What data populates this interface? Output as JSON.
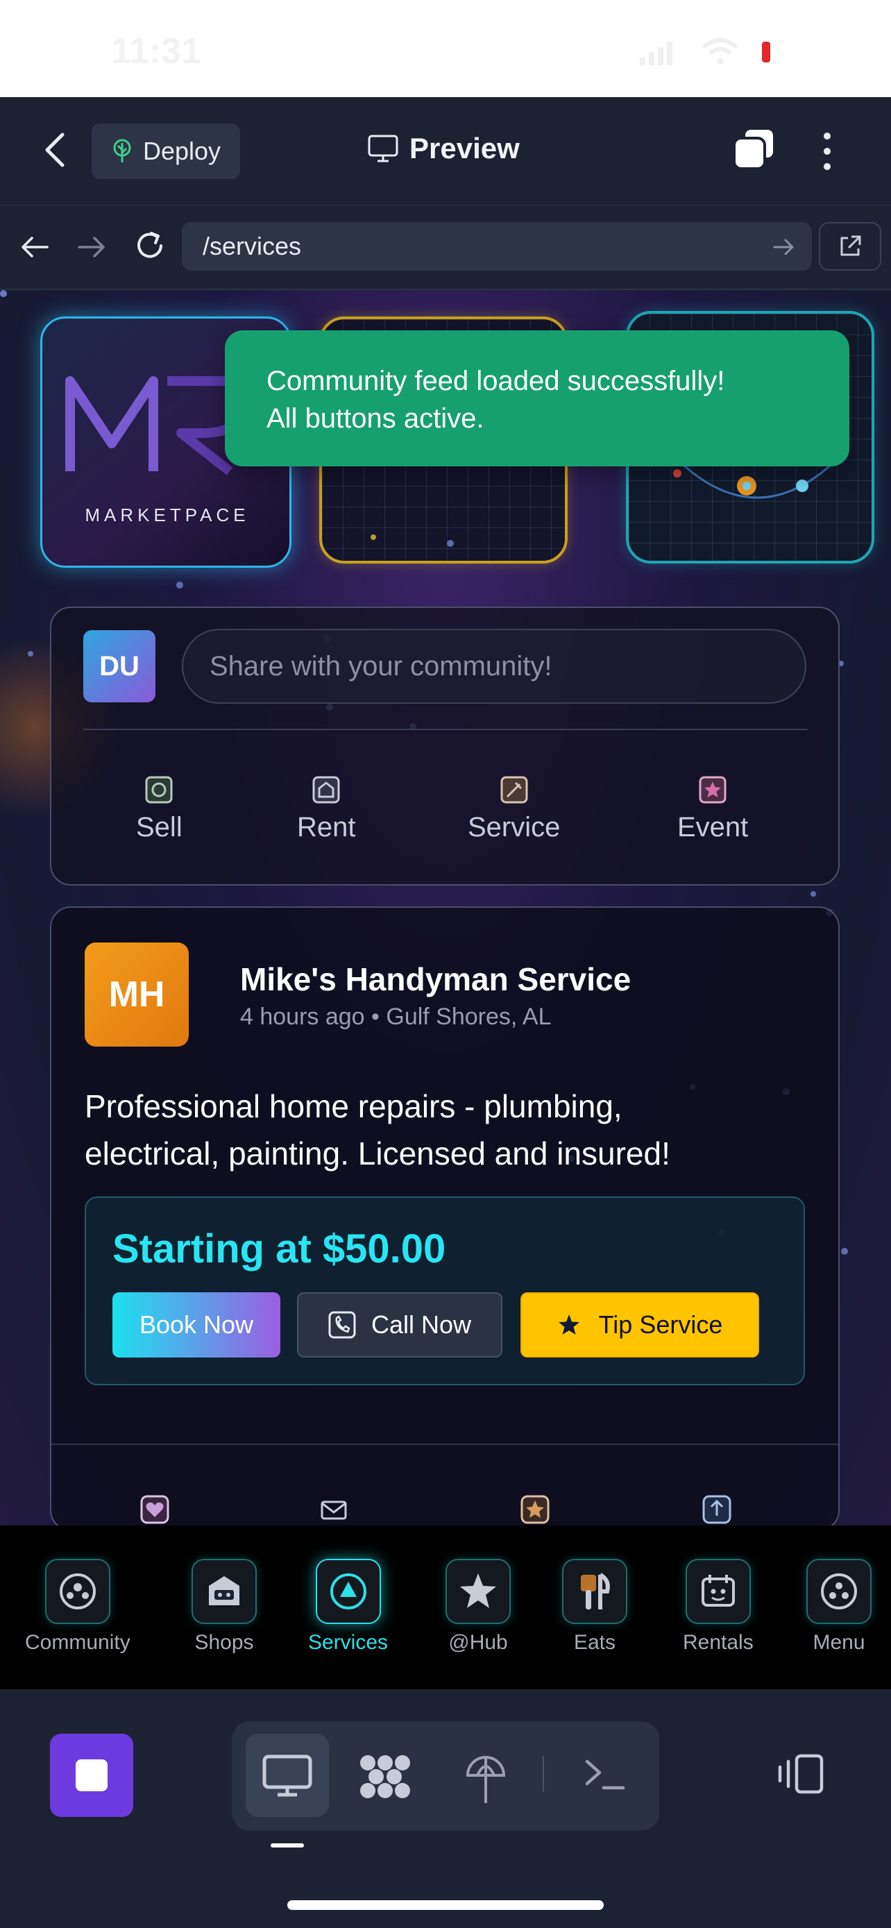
{
  "status_bar": {
    "time": "11:31"
  },
  "header": {
    "deploy_label": "Deploy",
    "preview_label": "Preview"
  },
  "browser": {
    "url": "/services"
  },
  "hero": {
    "marketplace_logo_text": "MARKETPACE"
  },
  "toast": {
    "line1": "Community feed loaded successfully!",
    "line2": "All buttons active."
  },
  "composer": {
    "avatar_initials": "DU",
    "placeholder": "Share with your community!",
    "actions": [
      {
        "label": "Sell",
        "icon": "tag-icon"
      },
      {
        "label": "Rent",
        "icon": "house-icon"
      },
      {
        "label": "Service",
        "icon": "tools-icon"
      },
      {
        "label": "Event",
        "icon": "star-icon"
      }
    ]
  },
  "post": {
    "avatar_initials": "MH",
    "author": "Mike's Handyman Service",
    "meta": "4 hours ago • Gulf Shores, AL",
    "body_line1": "Professional home repairs - plumbing,",
    "body_line2": "electrical, painting. Licensed and insured!",
    "price": "Starting at $50.00",
    "book_label": "Book Now",
    "call_label": "Call Now",
    "tip_label": "Tip Service",
    "reactions": [
      "heart-icon",
      "mail-icon",
      "star-icon",
      "share-icon"
    ]
  },
  "tabs": [
    {
      "label": "Community",
      "icon": "community-icon",
      "active": false
    },
    {
      "label": "Shops",
      "icon": "shop-icon",
      "active": false
    },
    {
      "label": "Services",
      "icon": "services-icon",
      "active": true
    },
    {
      "label": "@Hub",
      "icon": "star-icon",
      "active": false
    },
    {
      "label": "Eats",
      "icon": "utensils-icon",
      "active": false
    },
    {
      "label": "Rentals",
      "icon": "calendar-icon",
      "active": false
    },
    {
      "label": "Menu",
      "icon": "menu-icon",
      "active": false
    }
  ],
  "colors": {
    "accent_cyan": "#2be0e8",
    "toast_green": "#17a06f",
    "tip_yellow": "#ffc400",
    "stop_purple": "#6d3ae0"
  }
}
